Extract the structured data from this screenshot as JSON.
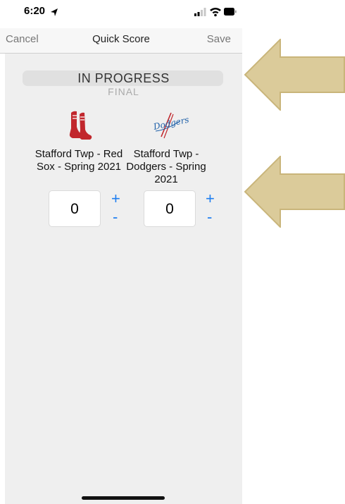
{
  "status_bar": {
    "time": "6:20"
  },
  "nav": {
    "cancel_label": "Cancel",
    "title": "Quick Score",
    "save_label": "Save"
  },
  "status_picker": {
    "selected": "IN PROGRESS",
    "next_option": "FINAL"
  },
  "teams": [
    {
      "name": "Stafford Twp - Red Sox - Spring 2021",
      "score": "0",
      "logo": "red-sox-logo"
    },
    {
      "name": "Stafford Twp - Dodgers - Spring 2021",
      "score": "0",
      "logo": "dodgers-logo"
    }
  ],
  "stepper": {
    "plus": "+",
    "minus": "-"
  },
  "colors": {
    "accent": "#1e7ef0",
    "arrow_fill": "#dbcb9a",
    "arrow_stroke": "#c9b57a",
    "red_sox": "#c1272d",
    "dodgers": "#1d5fa8"
  }
}
